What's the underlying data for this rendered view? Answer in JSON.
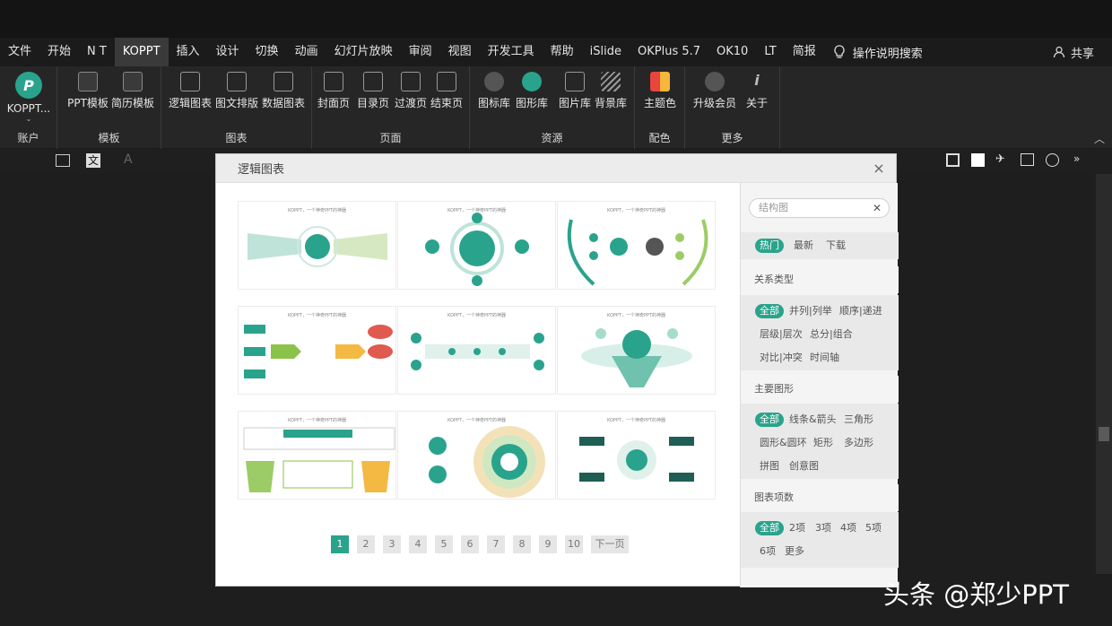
{
  "menu": [
    "文件",
    "开始",
    "N T",
    "KOPPT",
    "插入",
    "设计",
    "切换",
    "动画",
    "幻灯片放映",
    "审阅",
    "视图",
    "开发工具",
    "帮助",
    "iSlide",
    "OKPlus 5.7",
    "OK10",
    "LT",
    "简报"
  ],
  "menu_active": "KOPPT",
  "search_label": "操作说明搜索",
  "share_label": "共享",
  "ribbon": {
    "account": {
      "btn": "KOPPT...",
      "group": "账户"
    },
    "template": {
      "btns": [
        "PPT模板",
        "简历模板"
      ],
      "group": "模板"
    },
    "chart": {
      "btns": [
        "逻辑图表",
        "图文排版",
        "数据图表"
      ],
      "group": "图表"
    },
    "page": {
      "btns": [
        "封面页",
        "目录页",
        "过渡页",
        "结束页"
      ],
      "group": "页面"
    },
    "resource": {
      "btns": [
        "图标库",
        "图形库",
        "图片库",
        "背景库"
      ],
      "group": "资源"
    },
    "color": {
      "btns": [
        "主题色"
      ],
      "group": "配色"
    },
    "more": {
      "btns": [
        "升级会员",
        "关于"
      ],
      "group": "更多"
    }
  },
  "dialog": {
    "title": "逻辑图表",
    "close": "×",
    "thumb_title": "KOPPT，一个神奇PPT的神器",
    "pages": [
      "1",
      "2",
      "3",
      "4",
      "5",
      "6",
      "7",
      "8",
      "9",
      "10"
    ],
    "next": "下一页",
    "active_page": "1",
    "search_placeholder": "结构图",
    "sort": [
      "热门",
      "最新",
      "下载"
    ],
    "relation_head": "关系类型",
    "relation": [
      "全部",
      "并列|列举",
      "顺序|递进",
      "层级|层次",
      "总分|组合",
      "对比|冲突",
      "时间轴"
    ],
    "shape_head": "主要图形",
    "shape": [
      "全部",
      "线条&箭头",
      "三角形",
      "圆形&圆环",
      "矩形",
      "多边形",
      "拼图",
      "创意图"
    ],
    "count_head": "图表项数",
    "count": [
      "全部",
      "2项",
      "3项",
      "4项",
      "5项",
      "6项",
      "更多"
    ]
  },
  "watermark": "头条 @郑少PPT",
  "colors": {
    "accent": "#2aa38c",
    "dark": "#1e1e1e"
  }
}
